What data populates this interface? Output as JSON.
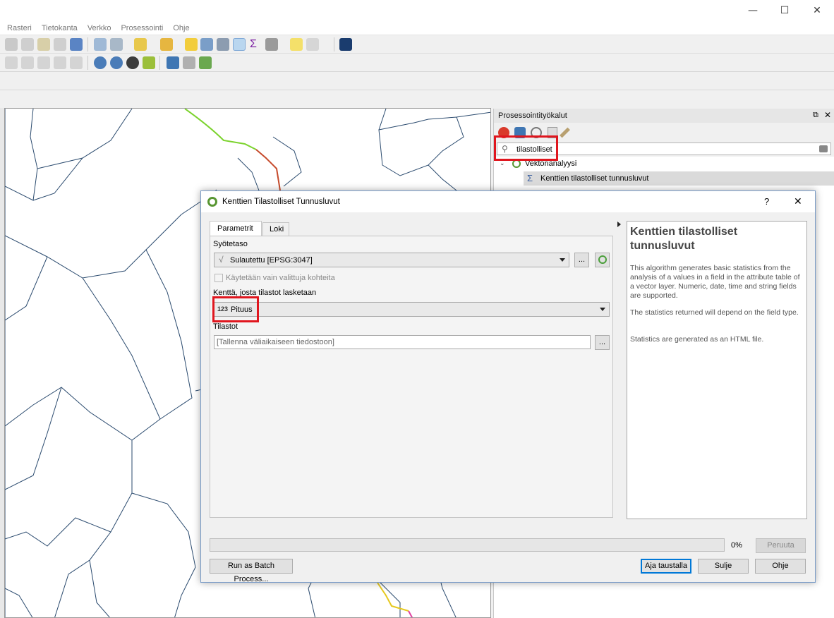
{
  "window": {
    "minimize_glyph": "—",
    "maximize_glyph": "☐",
    "close_glyph": "✕"
  },
  "menubar": {
    "items": [
      "Rasteri",
      "Tietokanta",
      "Verkko",
      "Prosessointi",
      "Ohje"
    ]
  },
  "toolbox": {
    "title": "Prosessointityökalut",
    "search_value": "tilastolliset",
    "tree": {
      "group_label": "Vektorianalyysi",
      "item_label": "Kenttien tilastolliset tunnusluvut"
    }
  },
  "dialog": {
    "title": "Kenttien Tilastolliset Tunnusluvut",
    "help_glyph": "?",
    "close_glyph": "✕",
    "tabs": [
      "Parametrit",
      "Loki"
    ],
    "params": {
      "input_label": "Syötetaso",
      "input_value": "Sulautettu [EPSG:3047]",
      "browse_label": "...",
      "selected_only_label": "Käytetään vain valittuja kohteita",
      "field_label": "Kenttä, josta tilastot lasketaan",
      "field_type_badge": "123",
      "field_value": "Pituus",
      "output_label": "Tilastot",
      "output_placeholder": "[Tallenna väliaikaiseen tiedostoon]"
    },
    "help": {
      "title": "Kenttien tilastolliset tunnusluvut",
      "paragraphs": [
        "This algorithm generates basic statistics from the analysis of a values in a field in the attribute table of a vector layer. Numeric, date, time and string fields are supported.",
        "The statistics returned will depend on the field type.",
        "Statistics are generated as an HTML file."
      ]
    },
    "progress": {
      "value": 0,
      "label": "0%"
    },
    "buttons": {
      "cancel": "Peruuta",
      "batch": "Run as Batch Process...",
      "run_background": "Aja taustalla",
      "close": "Sulje",
      "help": "Ohje"
    }
  },
  "colors": {
    "highlight_red": "#e0161e",
    "qgis_green": "#589632",
    "map_line": "#2a4a6e"
  }
}
